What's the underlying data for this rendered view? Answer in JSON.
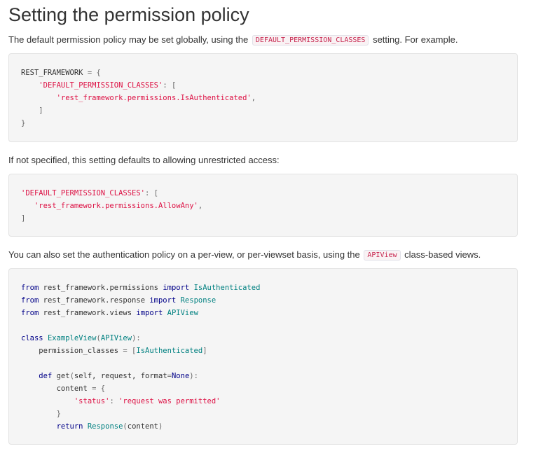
{
  "heading": "Setting the permission policy",
  "para1": {
    "before": "The default permission policy may be set globally, using the",
    "code": "DEFAULT_PERMISSION_CLASSES",
    "after": "setting. For example."
  },
  "code1": [
    [
      [
        "pln",
        "REST_FRAMEWORK "
      ],
      [
        "pun",
        "= {"
      ]
    ],
    [
      [
        "pln",
        "    "
      ],
      [
        "str",
        "'DEFAULT_PERMISSION_CLASSES'"
      ],
      [
        "pun",
        ": ["
      ]
    ],
    [
      [
        "pln",
        "        "
      ],
      [
        "str",
        "'rest_framework.permissions.IsAuthenticated'"
      ],
      [
        "pun",
        ","
      ]
    ],
    [
      [
        "pun",
        "    ]"
      ]
    ],
    [
      [
        "pun",
        "}"
      ]
    ]
  ],
  "para2": {
    "text": "If not specified, this setting defaults to allowing unrestricted access:"
  },
  "code2": [
    [
      [
        "str",
        "'DEFAULT_PERMISSION_CLASSES'"
      ],
      [
        "pun",
        ": ["
      ]
    ],
    [
      [
        "pln",
        "   "
      ],
      [
        "str",
        "'rest_framework.permissions.AllowAny'"
      ],
      [
        "pun",
        ","
      ]
    ],
    [
      [
        "pun",
        "]"
      ]
    ]
  ],
  "para3": {
    "before": "You can also set the authentication policy on a per-view, or per-viewset basis, using the",
    "code": "APIView",
    "after": "class-based views."
  },
  "code3": [
    [
      [
        "kw",
        "from"
      ],
      [
        "pln",
        " rest_framework.permissions "
      ],
      [
        "kw",
        "import"
      ],
      [
        "pln",
        " "
      ],
      [
        "cls",
        "IsAuthenticated"
      ]
    ],
    [
      [
        "kw",
        "from"
      ],
      [
        "pln",
        " rest_framework.response "
      ],
      [
        "kw",
        "import"
      ],
      [
        "pln",
        " "
      ],
      [
        "cls",
        "Response"
      ]
    ],
    [
      [
        "kw",
        "from"
      ],
      [
        "pln",
        " rest_framework.views "
      ],
      [
        "kw",
        "import"
      ],
      [
        "pln",
        " "
      ],
      [
        "cls",
        "APIView"
      ]
    ],
    [
      [
        "pln",
        ""
      ]
    ],
    [
      [
        "kw",
        "class"
      ],
      [
        "pln",
        " "
      ],
      [
        "cls",
        "ExampleView"
      ],
      [
        "pun",
        "("
      ],
      [
        "cls",
        "APIView"
      ],
      [
        "pun",
        "):"
      ]
    ],
    [
      [
        "pln",
        "    permission_classes "
      ],
      [
        "pun",
        "= ["
      ],
      [
        "cls",
        "IsAuthenticated"
      ],
      [
        "pun",
        "]"
      ]
    ],
    [
      [
        "pln",
        ""
      ]
    ],
    [
      [
        "pln",
        "    "
      ],
      [
        "kw",
        "def"
      ],
      [
        "pln",
        " get"
      ],
      [
        "pun",
        "("
      ],
      [
        "pln",
        "self, request, format"
      ],
      [
        "pun",
        "="
      ],
      [
        "kw",
        "None"
      ],
      [
        "pun",
        "):"
      ]
    ],
    [
      [
        "pln",
        "        content "
      ],
      [
        "pun",
        "= {"
      ]
    ],
    [
      [
        "pln",
        "            "
      ],
      [
        "str",
        "'status'"
      ],
      [
        "pun",
        ": "
      ],
      [
        "str",
        "'request was permitted'"
      ]
    ],
    [
      [
        "pun",
        "        }"
      ]
    ],
    [
      [
        "pln",
        "        "
      ],
      [
        "kw",
        "return"
      ],
      [
        "pln",
        " "
      ],
      [
        "cls",
        "Response"
      ],
      [
        "pun",
        "("
      ],
      [
        "pln",
        "content"
      ],
      [
        "pun",
        ")"
      ]
    ]
  ]
}
